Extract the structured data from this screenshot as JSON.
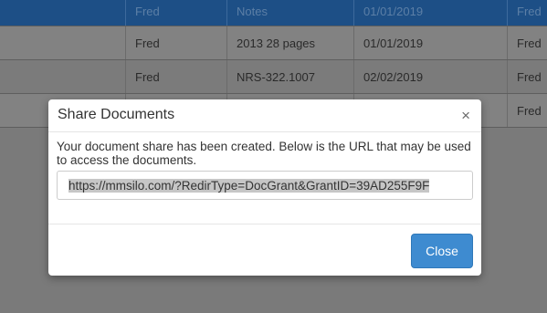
{
  "table": {
    "header": [
      "",
      "Fred",
      "Notes",
      "01/01/2019",
      "Fred"
    ],
    "rows": [
      [
        "",
        "Fred",
        "2013 28 pages",
        "01/01/2019",
        "Fred"
      ],
      [
        "",
        "Fred",
        "NRS-322.1007",
        "02/02/2019",
        "Fred"
      ],
      [
        "",
        "",
        "",
        "",
        "Fred"
      ]
    ]
  },
  "modal": {
    "title": "Share Documents",
    "close_symbol": "×",
    "message": "Your document share has been created. Below is the URL that may be used to access the documents.",
    "url": "https://mmsilo.com/?RedirType=DocGrant&GrantID=39AD255F9F",
    "close_label": "Close"
  },
  "colors": {
    "header_bg": "#1d4f86",
    "overlay_bg": "#7a7a7a",
    "button_primary": "#3e8bd0"
  }
}
